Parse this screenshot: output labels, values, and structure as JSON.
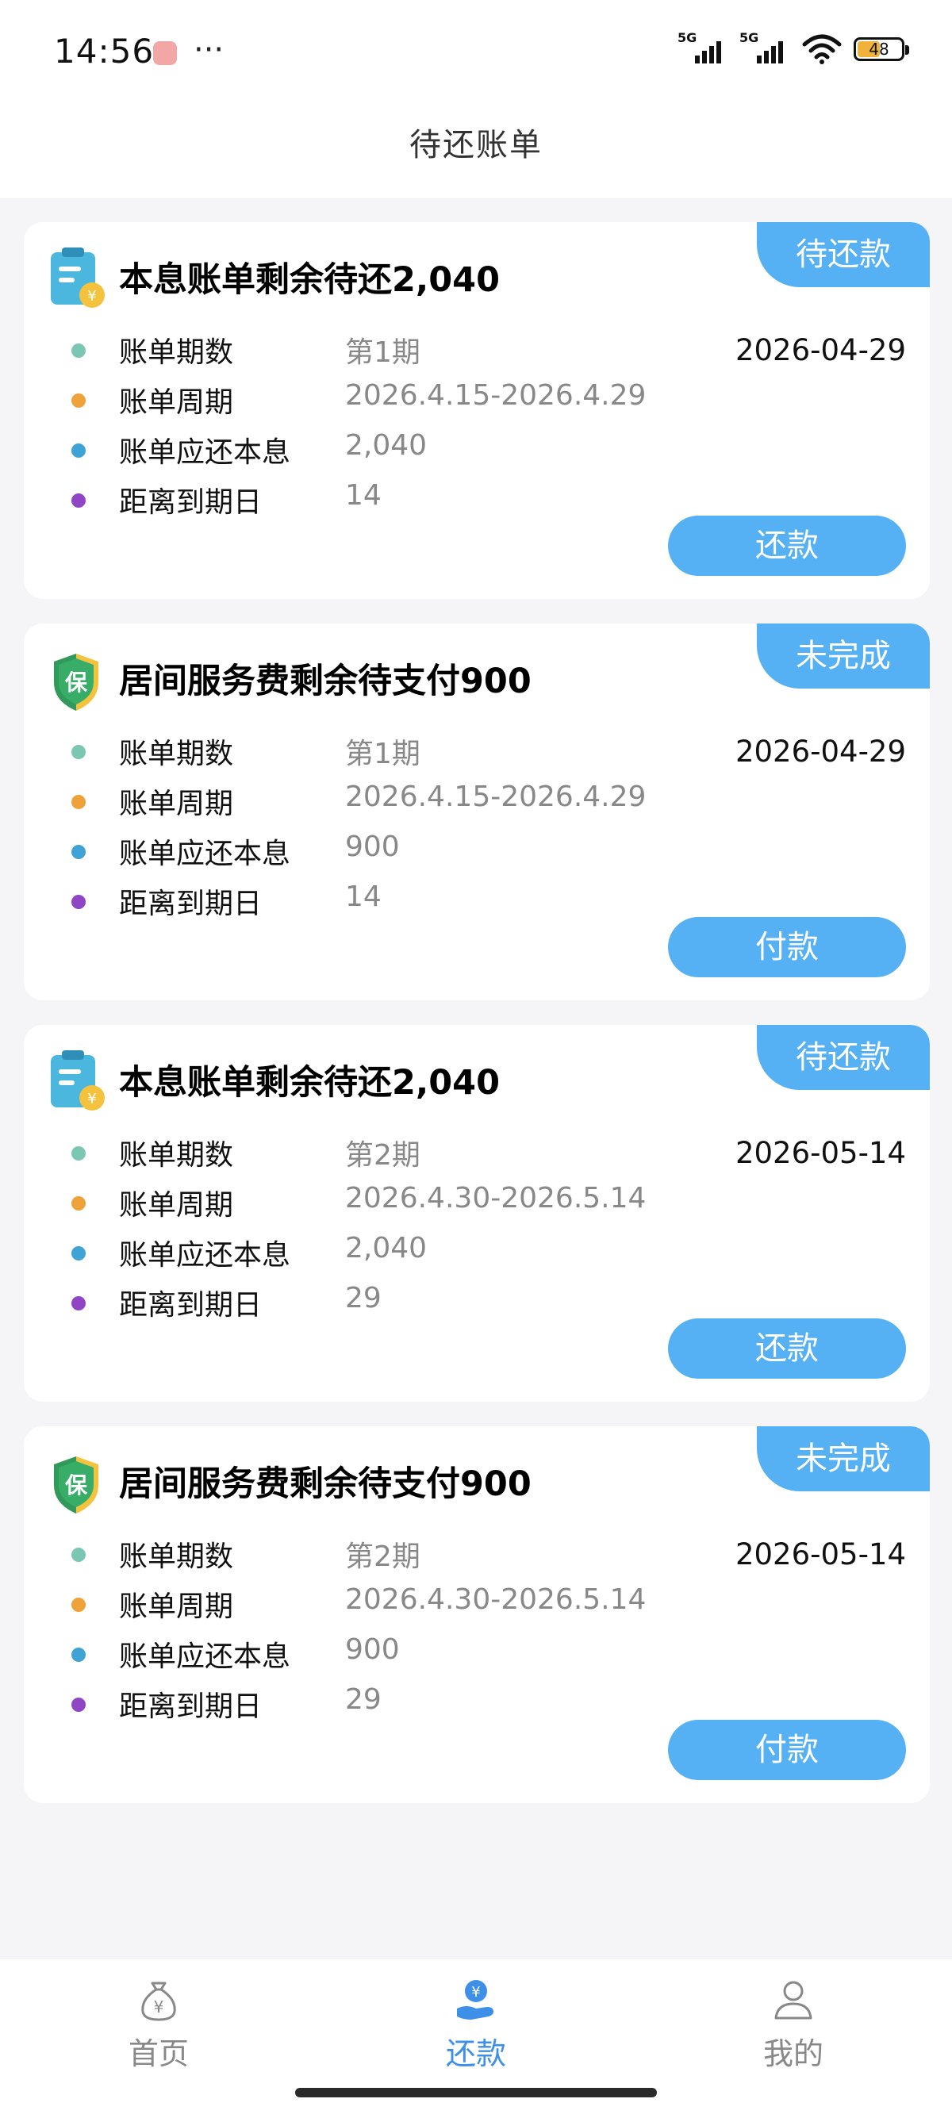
{
  "status_bar": {
    "time": "14:56",
    "more": "···",
    "signal_1": "5G",
    "signal_2": "5G",
    "battery": "48"
  },
  "header": {
    "title": "待还账单"
  },
  "colors": {
    "accent": "#55b1f4",
    "nav_active": "#3d8fe8",
    "dot_period": "#7cc7b4",
    "dot_cycle": "#f0a23a",
    "dot_amount": "#3fa3d6",
    "dot_days": "#8f45c4"
  },
  "bills": [
    {
      "icon": "bill-icon",
      "title": "本息账单剩余待还2,040",
      "tag": "待还款",
      "date": "2026-04-29",
      "rows": [
        {
          "label": "账单期数",
          "value": "第1期"
        },
        {
          "label": "账单周期",
          "value": "2026.4.15-2026.4.29"
        },
        {
          "label": "账单应还本息",
          "value": "2,040"
        },
        {
          "label": "距离到期日",
          "value": "14"
        }
      ],
      "button": "还款"
    },
    {
      "icon": "shield-icon",
      "title": "居间服务费剩余待支付900",
      "tag": "未完成",
      "date": "2026-04-29",
      "rows": [
        {
          "label": "账单期数",
          "value": "第1期"
        },
        {
          "label": "账单周期",
          "value": "2026.4.15-2026.4.29"
        },
        {
          "label": "账单应还本息",
          "value": "900"
        },
        {
          "label": "距离到期日",
          "value": "14"
        }
      ],
      "button": "付款"
    },
    {
      "icon": "bill-icon",
      "title": "本息账单剩余待还2,040",
      "tag": "待还款",
      "date": "2026-05-14",
      "rows": [
        {
          "label": "账单期数",
          "value": "第2期"
        },
        {
          "label": "账单周期",
          "value": "2026.4.30-2026.5.14"
        },
        {
          "label": "账单应还本息",
          "value": "2,040"
        },
        {
          "label": "距离到期日",
          "value": "29"
        }
      ],
      "button": "还款"
    },
    {
      "icon": "shield-icon",
      "title": "居间服务费剩余待支付900",
      "tag": "未完成",
      "date": "2026-05-14",
      "rows": [
        {
          "label": "账单期数",
          "value": "第2期"
        },
        {
          "label": "账单周期",
          "value": "2026.4.30-2026.5.14"
        },
        {
          "label": "账单应还本息",
          "value": "900"
        },
        {
          "label": "距离到期日",
          "value": "29"
        }
      ],
      "button": "付款"
    }
  ],
  "nav": {
    "items": [
      {
        "label": "首页",
        "icon": "home-money-bag-icon"
      },
      {
        "label": "还款",
        "icon": "repay-hand-icon",
        "active": true
      },
      {
        "label": "我的",
        "icon": "user-icon"
      }
    ]
  }
}
